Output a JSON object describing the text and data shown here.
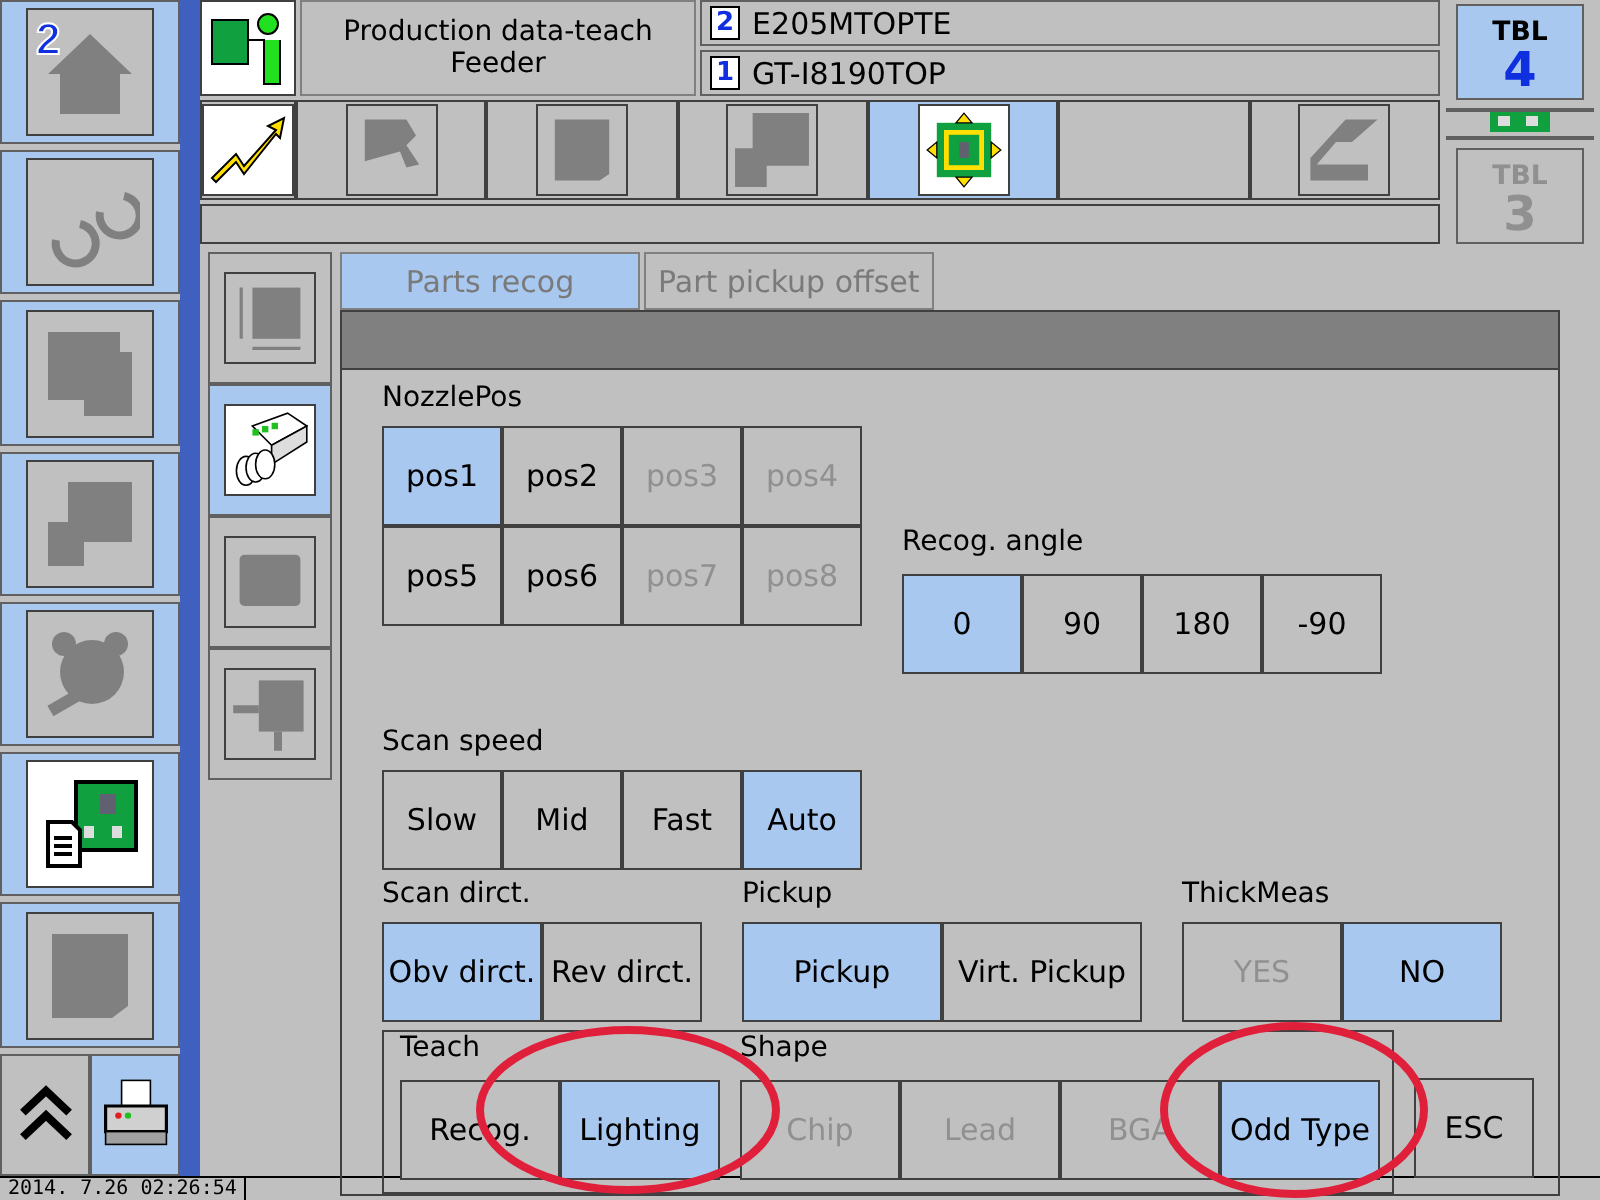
{
  "sidebar": {
    "items": [
      {
        "kind": "home",
        "badge": "2",
        "selected": false
      },
      {
        "kind": "swirl",
        "selected": false
      },
      {
        "kind": "board",
        "selected": false
      },
      {
        "kind": "step",
        "selected": false
      },
      {
        "kind": "bear",
        "selected": false
      },
      {
        "kind": "pcb-doc",
        "selected": true
      },
      {
        "kind": "part",
        "selected": false
      }
    ],
    "bottom": [
      {
        "kind": "chevrons",
        "selected": false
      },
      {
        "kind": "printer",
        "selected": true
      }
    ]
  },
  "header": {
    "title": [
      "Production data-teach",
      "Feeder"
    ],
    "recipes": [
      {
        "number": "2",
        "name": "E205MTOPTE"
      },
      {
        "number": "1",
        "name": "GT-I8190TOP"
      }
    ],
    "tables": [
      {
        "label": "TBL",
        "number": "4",
        "selected": true
      },
      {
        "label": "TBL",
        "number": "3",
        "selected": false
      }
    ]
  },
  "toolbar": {
    "tools": [
      {
        "kind": "head",
        "selected": false
      },
      {
        "kind": "square",
        "selected": false
      },
      {
        "kind": "step",
        "selected": false
      },
      {
        "kind": "move",
        "selected": true
      },
      {
        "kind": "empty",
        "selected": false
      },
      {
        "kind": "lane",
        "selected": false
      }
    ]
  },
  "side_tabs": [
    {
      "kind": "size",
      "selected": false
    },
    {
      "kind": "nozzles",
      "selected": true
    },
    {
      "kind": "block",
      "selected": false
    },
    {
      "kind": "probe",
      "selected": false
    }
  ],
  "dialog": {
    "tabs": [
      {
        "label": "Parts recog",
        "selected": true
      },
      {
        "label": "Part pickup offset",
        "selected": false
      }
    ],
    "nozzle_pos": {
      "label": "NozzlePos",
      "options": [
        {
          "label": "pos1",
          "selected": true,
          "disabled": false
        },
        {
          "label": "pos2",
          "selected": false,
          "disabled": false
        },
        {
          "label": "pos3",
          "selected": false,
          "disabled": true
        },
        {
          "label": "pos4",
          "selected": false,
          "disabled": true
        },
        {
          "label": "pos5",
          "selected": false,
          "disabled": false
        },
        {
          "label": "pos6",
          "selected": false,
          "disabled": false
        },
        {
          "label": "pos7",
          "selected": false,
          "disabled": true
        },
        {
          "label": "pos8",
          "selected": false,
          "disabled": true
        }
      ]
    },
    "recog_angle": {
      "label": "Recog. angle",
      "options": [
        {
          "label": "0",
          "selected": true,
          "disabled": false
        },
        {
          "label": "90",
          "selected": false,
          "disabled": false
        },
        {
          "label": "180",
          "selected": false,
          "disabled": false
        },
        {
          "label": "-90",
          "selected": false,
          "disabled": false
        }
      ]
    },
    "scan_speed": {
      "label": "Scan speed",
      "options": [
        {
          "label": "Slow",
          "selected": false,
          "disabled": false
        },
        {
          "label": "Mid",
          "selected": false,
          "disabled": false
        },
        {
          "label": "Fast",
          "selected": false,
          "disabled": false
        },
        {
          "label": "Auto",
          "selected": true,
          "disabled": false
        }
      ]
    },
    "scan_direction": {
      "label": "Scan dirct.",
      "options": [
        {
          "label": "Obv dirct.",
          "selected": true,
          "disabled": false
        },
        {
          "label": "Rev dirct.",
          "selected": false,
          "disabled": false
        }
      ]
    },
    "pickup": {
      "label": "Pickup",
      "options": [
        {
          "label": "Pickup",
          "selected": true,
          "disabled": false
        },
        {
          "label": "Virt. Pickup",
          "selected": false,
          "disabled": false
        }
      ]
    },
    "thick_meas": {
      "label": "ThickMeas",
      "options": [
        {
          "label": "YES",
          "selected": false,
          "disabled": true
        },
        {
          "label": "NO",
          "selected": true,
          "disabled": false
        }
      ]
    },
    "teach": {
      "label": "Teach",
      "options": [
        {
          "label": "Recog.",
          "selected": false,
          "disabled": false
        },
        {
          "label": "Lighting",
          "selected": true,
          "disabled": false
        }
      ]
    },
    "shape": {
      "label": "Shape",
      "options": [
        {
          "label": "Chip",
          "selected": false,
          "disabled": true
        },
        {
          "label": "Lead",
          "selected": false,
          "disabled": true
        },
        {
          "label": "BGA",
          "selected": false,
          "disabled": true
        },
        {
          "label": "Odd Type",
          "selected": true,
          "disabled": false
        }
      ]
    },
    "esc": "ESC"
  },
  "status_bar": {
    "datetime": "2014. 7.26 02:26:54"
  }
}
